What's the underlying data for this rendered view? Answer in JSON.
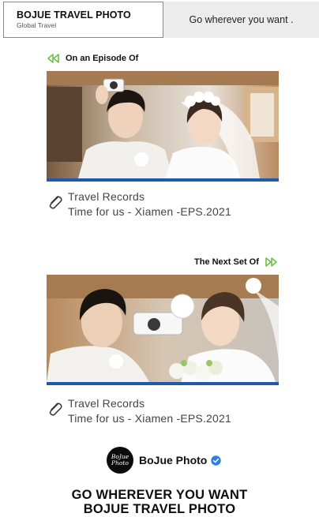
{
  "header": {
    "brand_title": "BOJUE TRAVEL PHOTO",
    "brand_subtitle": "Global Travel",
    "slogan": "Go wherever you want ."
  },
  "sections": [
    {
      "heading": "On an Episode Of",
      "heading_icon": "double-chevron-left-icon",
      "photo_alt": "Couple in wedding attire with vintage camera",
      "record_title": "Travel Records",
      "record_subtitle": "Time for us - Xiamen -EPS.2021"
    },
    {
      "heading": "The Next Set Of",
      "heading_icon": "double-chevron-right-icon",
      "photo_alt": "Couple in wedding attire holding a white camera",
      "record_title": "Travel Records",
      "record_subtitle": "Time for us - Xiamen -EPS.2021"
    }
  ],
  "account": {
    "avatar_text": "BoJue Photo",
    "name": "BoJue Photo",
    "verified_icon": "verified-badge-icon"
  },
  "footer": {
    "line1": "GO WHEREVER YOU WANT",
    "line2": "BOJUE TRAVEL PHOTO"
  },
  "colors": {
    "accent_green": "#6cc04a",
    "accent_blue": "#1f58ad",
    "verified_blue": "#2f7fd8"
  }
}
